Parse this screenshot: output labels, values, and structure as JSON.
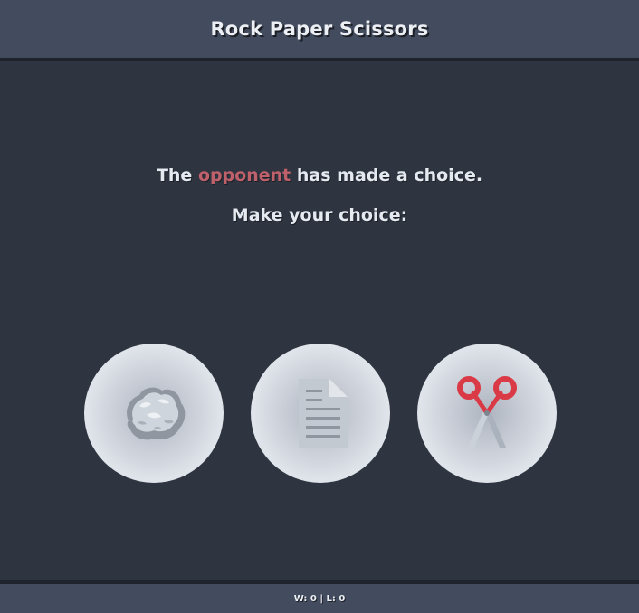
{
  "header": {
    "title": "Rock Paper Scissors"
  },
  "prompt": {
    "line1_prefix": "The ",
    "line1_highlight": "opponent",
    "line1_suffix": " has made a choice.",
    "line2": "Make your choice:"
  },
  "choices": [
    {
      "name": "rock",
      "icon": "rock-icon"
    },
    {
      "name": "paper",
      "icon": "paper-icon"
    },
    {
      "name": "scissors",
      "icon": "scissors-icon"
    }
  ],
  "footer": {
    "score": "W: 0 | L: 0"
  },
  "colors": {
    "background": "#2e3440",
    "bar": "#434c5e",
    "accent": "#bf616a",
    "text": "#e5e9f0",
    "choice_bg": "#e5e9f0"
  }
}
